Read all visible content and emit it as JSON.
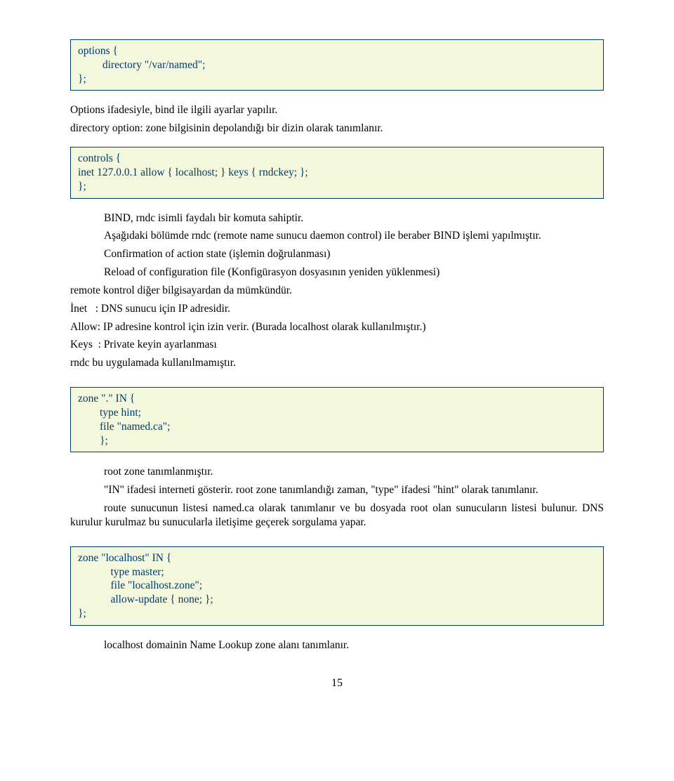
{
  "codebox1": {
    "line1": "options {",
    "line2": "         directory \"/var/named\";",
    "line3": "};"
  },
  "para1": "Options ifadesiyle, bind ile ilgili ayarlar yapılır.",
  "para2": "directory option: zone bilgisinin depolandığı bir dizin olarak tanımlanır.",
  "codebox2": {
    "line1": "controls {",
    "line2": "inet 127.0.0.1 allow { localhost; } keys { rndckey; };",
    "line3": "};"
  },
  "para3a": "BIND, rndc isimli faydalı bir komuta sahiptir.",
  "para3b": "Aşağıdaki bölümde rndc (remote name sunucu daemon control) ile beraber BIND işlemi yapılmıştır.",
  "para3c": "Confirmation of action state (işlemin doğrulanması)",
  "para3d": "Reload of configuration file (Konfigürasyon dosyasının yeniden yüklenmesi)",
  "para4": "remote kontrol diğer bilgisayardan da mümkündür.",
  "para5": "İnet   : DNS sunucu için IP adresidir.",
  "para6": "Allow: IP adresine kontrol için izin verir. (Burada localhost olarak kullanılmıştır.)",
  "para7": "Keys  : Private keyin ayarlanması",
  "para8": "rndc bu uygulamada kullanılmamıştır.",
  "codebox3": {
    "line1": "zone \".\" IN {",
    "line2": "        type hint;",
    "line3": "        file \"named.ca\";",
    "line4": "        };"
  },
  "para9": "root zone tanımlanmıştır.",
  "para10": "\"IN\" ifadesi interneti gösterir. root zone tanımlandığı zaman, \"type\" ifadesi \"hint\" olarak tanımlanır.",
  "para11": "route sunucunun listesi named.ca olarak tanımlanır ve bu dosyada root olan sunucuların listesi bulunur. DNS kurulur kurulmaz bu sunucularla iletişime geçerek sorgulama yapar.",
  "codebox4": {
    "line1": "zone \"localhost\" IN {",
    "line2": "            type master;",
    "line3": "            file \"localhost.zone\";",
    "line4": "            allow-update { none; };",
    "line5": "};"
  },
  "para12": "localhost domainin Name Lookup zone alanı tanımlanır.",
  "pagenum": "15"
}
